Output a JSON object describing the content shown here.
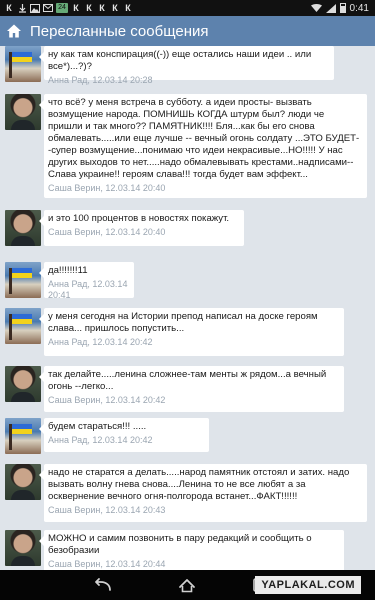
{
  "status_bar": {
    "icons": [
      "vk-icon",
      "download-icon",
      "image-icon",
      "mail-icon",
      "notification-count",
      "vk-icon",
      "vk-icon",
      "vk-icon",
      "vk-icon",
      "vk-icon"
    ],
    "notification_count": "24",
    "vk_letter": "К",
    "time": "0:41"
  },
  "header": {
    "title": "Пересланные сообщения",
    "icon": "home-icon",
    "color": "#5d82ad"
  },
  "messages": [
    {
      "avatar": "flag-avatar",
      "text": "ну как там конспирация((-)) еще остались наши идеи .. или все*)...?)?",
      "meta": "Анна Рад, 12.03.14 20:28"
    },
    {
      "avatar": "person-avatar",
      "text": "что всё? у меня встреча в субботу. а идеи просты- вызвать возмущение народа. ПОМНИШЬ КОГДА штурм был? люди че пришли и так много?? ПАМЯТНИК!!!! Бля...как бы его снова обмалевать.....или еще лучше -- вечный огонь солдату ...ЭТО БУДЕТ--супер возмущение...понимаю что идеи некрасивые...НО!!!!! У нас других выходов то нет.....надо обмалевывать крестами..надписами--Слава украине!! героям слава!!! тогда будет вам эффект...",
      "meta": "Саша Верин, 12.03.14 20:40"
    },
    {
      "avatar": "person-avatar",
      "text": "и это 100 процентов в новостях покажут.",
      "meta": "Саша Верин, 12.03.14 20:40"
    },
    {
      "avatar": "flag-avatar",
      "text": "да!!!!!!!11",
      "meta": "Анна Рад, 12.03.14 20:41"
    },
    {
      "avatar": "flag-avatar",
      "text": "у меня сегодня на Истории препод написал на доске героям слава... пришлось попустить...",
      "meta": "Анна Рад, 12.03.14 20:42"
    },
    {
      "avatar": "person-avatar",
      "text": "так делайте.....ленина сложнее-там менты ж рядом...а вечный огонь --легко...",
      "meta": "Саша Верин, 12.03.14 20:42"
    },
    {
      "avatar": "flag-avatar",
      "text": "будем стараться!!! .....",
      "meta": "Анна Рад, 12.03.14 20:42"
    },
    {
      "avatar": "person-avatar",
      "text": "надо не старатся а делать.....народ памятник отстоял и затих. надо вызвать волну гнева снова....Ленина то не все любят а за осквернение вечного огня-полгорода встанет...ФАКТ!!!!!!",
      "meta": "Саша Верин, 12.03.14 20:43"
    },
    {
      "avatar": "person-avatar",
      "text": "МОЖНО и самим позвонить в пару редакций и сообщить о безобразии",
      "meta": "Саша Верин, 12.03.14 20:44"
    }
  ],
  "nav_bar": {
    "buttons": [
      "back-icon",
      "home-icon",
      "recents-icon"
    ],
    "watermark": "YAPLAKAL.COM"
  }
}
